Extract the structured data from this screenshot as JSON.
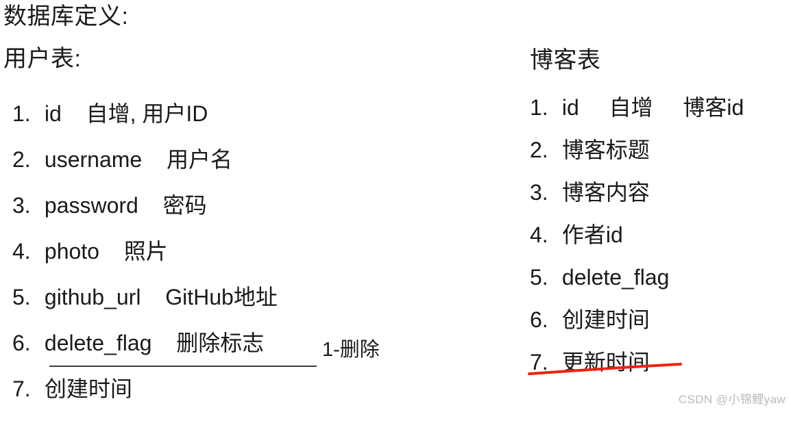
{
  "document": {
    "title": "数据库定义:",
    "background_color": "#ffffff",
    "text_color": "#1a1a1a"
  },
  "left_column": {
    "table_title": "用户表:",
    "items": [
      {
        "num": "1.",
        "field": "id",
        "desc": "自增, 用户ID"
      },
      {
        "num": "2.",
        "field": "username",
        "desc": "用户名"
      },
      {
        "num": "3.",
        "field": "password",
        "desc": "密码"
      },
      {
        "num": "4.",
        "field": "photo",
        "desc": "照片"
      },
      {
        "num": "5.",
        "field": "github_url",
        "desc": "GitHub地址"
      },
      {
        "num": "6.",
        "field": "delete_flag",
        "desc": "删除标志"
      },
      {
        "num": "7.",
        "field": "创建时间",
        "desc": ""
      }
    ],
    "annotation_note": "1-删除",
    "underline_color": "#3a3a3a"
  },
  "right_column": {
    "table_title": "博客表",
    "items": [
      {
        "num": "1.",
        "field": "id",
        "desc": "自增",
        "desc2": "博客id"
      },
      {
        "num": "2.",
        "field": "博客标题",
        "desc": "",
        "desc2": ""
      },
      {
        "num": "3.",
        "field": "博客内容",
        "desc": "",
        "desc2": ""
      },
      {
        "num": "4.",
        "field": "作者id",
        "desc": "",
        "desc2": ""
      },
      {
        "num": "5.",
        "field": "delete_flag",
        "desc": "",
        "desc2": ""
      },
      {
        "num": "6.",
        "field": "创建时间",
        "desc": "",
        "desc2": ""
      },
      {
        "num": "7.",
        "field": "更新时间",
        "desc": "",
        "desc2": ""
      }
    ],
    "strikethrough_item_index": 6,
    "strikethrough_color": "#ee2211"
  },
  "watermark": {
    "text": "CSDN @小锦鲤yaw",
    "color": "#b9b9b9"
  }
}
